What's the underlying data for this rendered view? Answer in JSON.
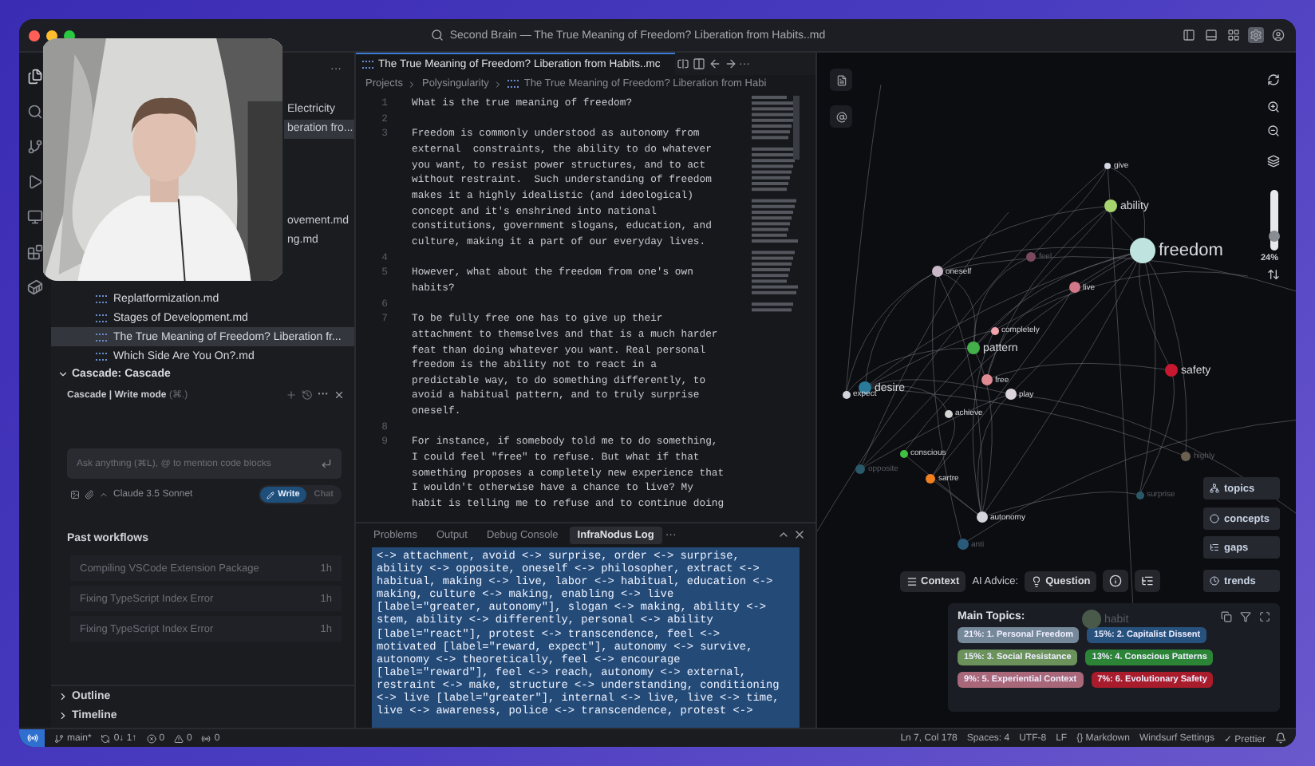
{
  "window": {
    "title": "Second Brain — The True Meaning of Freedom? Liberation from Habits..md"
  },
  "sidebar": {
    "more": "···",
    "partial_items": [
      {
        "label": "Electricity",
        "selected": false
      },
      {
        "label": "beration fro...",
        "selected": true
      },
      {
        "label": "ovement.md",
        "selected": false
      },
      {
        "label": "ng.md",
        "selected": false
      }
    ],
    "files": [
      {
        "name": "Replatformization.md",
        "selected": false
      },
      {
        "name": "Stages of Development.md",
        "selected": false
      },
      {
        "name": "The True Meaning of Freedom? Liberation fr...",
        "selected": true
      },
      {
        "name": "Which Side Are You On?.md",
        "selected": false
      }
    ],
    "cascade": {
      "section": "Cascade: Cascade",
      "expanded": true,
      "title": "Cascade | Write mode",
      "shortcut": "(⌘.)",
      "placeholder": "Ask anything (⌘L), @ to mention code blocks",
      "model": "Claude 3.5 Sonnet",
      "more": "···",
      "modes": [
        {
          "label": "Write",
          "selected": true
        },
        {
          "label": "Chat",
          "selected": false
        }
      ]
    },
    "past_workflows": {
      "title": "Past workflows",
      "items": [
        {
          "name": "Compiling VSCode Extension Package",
          "age": "1h"
        },
        {
          "name": "Fixing TypeScript Index Error",
          "age": "1h"
        },
        {
          "name": "Fixing TypeScript Index Error",
          "age": "1h"
        }
      ]
    },
    "sections": [
      {
        "label": "Outline",
        "expanded": false
      },
      {
        "label": "Timeline",
        "expanded": false
      }
    ]
  },
  "editor": {
    "tab": "The True Meaning of Freedom? Liberation from Habits..mc",
    "more": "···",
    "breadcrumbs": [
      "Projects",
      "Polysingularity",
      "The True Meaning of Freedom? Liberation from Habi"
    ],
    "lines": [
      {
        "number": "1",
        "text": "What is the true meaning of freedom?"
      },
      {
        "number": "2"
      },
      {
        "number": "3",
        "text": "Freedom is commonly understood as autonomy from external  constraints, the ability to do whatever you want, to resist power structures, and to act without restraint.  Such understanding of freedom makes it a highly idealistic (and ideological) concept and it's enshrined into national constitutions, government slogans, education, and culture, making it a part of our everyday lives."
      },
      {
        "number": "4"
      },
      {
        "number": "5",
        "text": "However, what about the freedom from one's own habits?"
      },
      {
        "number": "6"
      },
      {
        "number": "7",
        "text": "To be fully free one has to give up their attachment to themselves and that is a much harder feat than doing whatever you want. Real personal freedom is the ability not to react in a predictable way, to do something differently, to avoid a habitual pattern, and to truly surprise oneself."
      },
      {
        "number": "8"
      },
      {
        "number": "9",
        "text": "For instance, if somebody told me to do something, I could feel \"free\" to refuse. But what if that something proposes a completely new experience that I wouldn't otherwise have a chance to live? My habit is telling me to refuse and to continue doing"
      }
    ]
  },
  "panel": {
    "tabs": [
      {
        "label": "Problems",
        "selected": false
      },
      {
        "label": "Output",
        "selected": false
      },
      {
        "label": "Debug Console",
        "selected": false
      },
      {
        "label": "InfraNodus Log",
        "selected": true
      }
    ],
    "more": "···",
    "log_lines": [
      "<-> attachment, avoid <-> surprise, order <-> surprise,",
      "ability <-> opposite, oneself <-> philosopher, extract <->",
      "habitual, making <-> live, labor <-> habitual, education <->",
      "making, culture <-> making, enabling <-> live",
      "[label=\"greater, autonomy\"], slogan <-> making, ability <->",
      "stem, ability <-> differently, personal <-> ability",
      "[label=\"react\"], protest <-> transcendence, feel <->",
      "motivated [label=\"reward, expect\"], autonomy <-> survive,",
      "autonomy <-> theoretically, feel <-> encourage",
      "[label=\"reward\"], feel <-> reach, autonomy <-> external,",
      "restraint <-> make, structure <-> understanding, conditioning",
      "<-> live [label=\"greater\"], internal <-> live, live <-> time,",
      "live <-> awareness, police <-> transcendence, protest <->"
    ]
  },
  "graph": {
    "zoom": {
      "level": 0.24,
      "reading": "24%"
    },
    "nodes": [
      {
        "label": "give",
        "color": "#d4d8e4",
        "dim": false
      },
      {
        "label": "ability",
        "color": "#a6d46e",
        "dim": false
      },
      {
        "label": "freedom",
        "color": "#bfe4e0",
        "dim": false
      },
      {
        "label": "oneself",
        "color": "#c8b8c8",
        "dim": false
      },
      {
        "label": "feel",
        "color": "#7a4a5c",
        "dim": true
      },
      {
        "label": "live",
        "color": "#d27888",
        "dim": false
      },
      {
        "label": "completely",
        "color": "#f2a4ac",
        "dim": false
      },
      {
        "label": "pattern",
        "color": "#44b04a",
        "dim": false
      },
      {
        "label": "free",
        "color": "#e08a92",
        "dim": false
      },
      {
        "label": "play",
        "color": "#dcd4dc",
        "dim": false
      },
      {
        "label": "safety",
        "color": "#c81830",
        "dim": false
      },
      {
        "label": "desire",
        "color": "#2a7a9a",
        "dim": false
      },
      {
        "label": "expect",
        "color": "#d4d4dc",
        "dim": false
      },
      {
        "label": "achieve",
        "color": "#d4d4d4",
        "dim": false
      },
      {
        "label": "conscious",
        "color": "#40c040",
        "dim": false
      },
      {
        "label": "opposite",
        "color": "#2a5a6a",
        "dim": true
      },
      {
        "label": "sartre",
        "color": "#f08020",
        "dim": false
      },
      {
        "label": "autonomy",
        "color": "#d4d4dc",
        "dim": false
      },
      {
        "label": "anti",
        "color": "#2a5a7a",
        "dim": true
      },
      {
        "label": "highly",
        "color": "#6a6050",
        "dim": true
      },
      {
        "label": "surprise",
        "color": "#2a5a6a",
        "dim": true
      },
      {
        "label": "habit",
        "color": "#4a5a4a",
        "dim": true
      }
    ],
    "views": [
      "topics",
      "concepts",
      "gaps",
      "trends"
    ],
    "context": "Context",
    "ai_advice": "AI Advice:",
    "question": "Question",
    "topics": {
      "title": "Main Topics:",
      "tags": [
        {
          "label": "21%: 1. Personal Freedom",
          "color": "#76899a"
        },
        {
          "label": "15%: 2. Capitalist Dissent",
          "color": "#27527e"
        },
        {
          "label": "15%: 3. Social Resistance",
          "color": "#6a925a"
        },
        {
          "label": "13%: 4. Conscious Patterns",
          "color": "#2c8436"
        },
        {
          "label": "9%: 5. Experiential Context",
          "color": "#a8687a"
        },
        {
          "label": "7%: 6. Evolutionary Safety",
          "color": "#a81c2c"
        }
      ]
    }
  },
  "status_bar": {
    "left": [
      {
        "kind": "branch",
        "text": "main*"
      },
      {
        "kind": "sync",
        "text": "0↓ 1↑"
      },
      {
        "kind": "error",
        "text": "0"
      },
      {
        "kind": "warning",
        "text": "0"
      },
      {
        "kind": "ports",
        "text": "0"
      }
    ],
    "right": [
      "Ln 7, Col 178",
      "Spaces: 4",
      "UTF-8",
      "LF",
      "{} Markdown",
      "Windsurf Settings",
      "✓ Prettier"
    ]
  }
}
